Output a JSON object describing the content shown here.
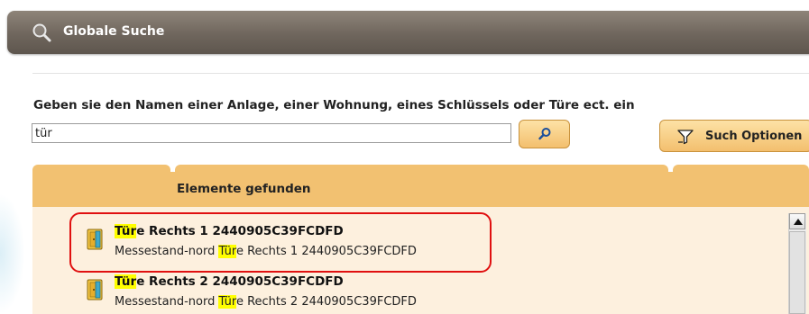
{
  "header": {
    "title": "Globale Suche",
    "icon": "search-icon"
  },
  "search": {
    "instruction": "Geben sie den Namen einer Anlage, einer Wohnung, eines Schlüssels oder Türe ect. ein",
    "value": "tür",
    "search_button_icon": "search-icon",
    "options_label": "Such Optionen",
    "options_icon": "filter-icon"
  },
  "results": {
    "header_label": "Elemente gefunden",
    "items": [
      {
        "name_highlight": "Tür",
        "name_rest": "e Rechts 1 2440905C39FCDFD",
        "path_prefix": "Messestand-nord ",
        "path_highlight": "Tür",
        "path_rest": "e Rechts 1 2440905C39FCDFD",
        "icon": "door-icon",
        "selected": true
      },
      {
        "name_highlight": "Tür",
        "name_rest": "e Rechts 2 2440905C39FCDFD",
        "path_prefix": "Messestand-nord ",
        "path_highlight": "Tür",
        "path_rest": "e Rechts 2 2440905C39FCDFD",
        "icon": "door-icon",
        "selected": false
      }
    ]
  },
  "colors": {
    "header_bg": "#6f665d",
    "accent_orange": "#f2c171",
    "row_bg": "#fdf0de",
    "highlight": "#ffff00",
    "callout": "#e01010"
  }
}
